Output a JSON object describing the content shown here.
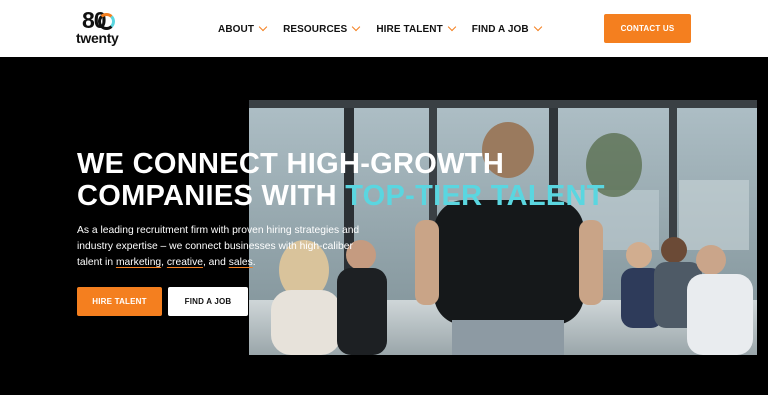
{
  "brand": {
    "logo_number": "80",
    "logo_word": "twenty"
  },
  "nav": {
    "items": [
      {
        "label": "ABOUT"
      },
      {
        "label": "RESOURCES"
      },
      {
        "label": "HIRE TALENT"
      },
      {
        "label": "FIND A JOB"
      }
    ],
    "contact_label": "CONTACT US"
  },
  "hero": {
    "headline_line1": "WE CONNECT HIGH-GROWTH",
    "headline_line2_prefix": "COMPANIES WITH ",
    "headline_line2_accent": "TOP-TIER TALENT",
    "subcopy_main": "As a leading recruitment firm with proven hiring strategies and industry expertise – we connect businesses with high-caliber talent in ",
    "subcopy_link1": "marketing",
    "subcopy_sep1": ", ",
    "subcopy_link2": "creative",
    "subcopy_sep2": ", and ",
    "subcopy_link3": "sales",
    "subcopy_end": ".",
    "primary_button": "HIRE TALENT",
    "secondary_button": "FIND A JOB"
  },
  "colors": {
    "accent_orange": "#f47f1f",
    "accent_cyan": "#5ad6e0",
    "hero_background": "#000000"
  }
}
